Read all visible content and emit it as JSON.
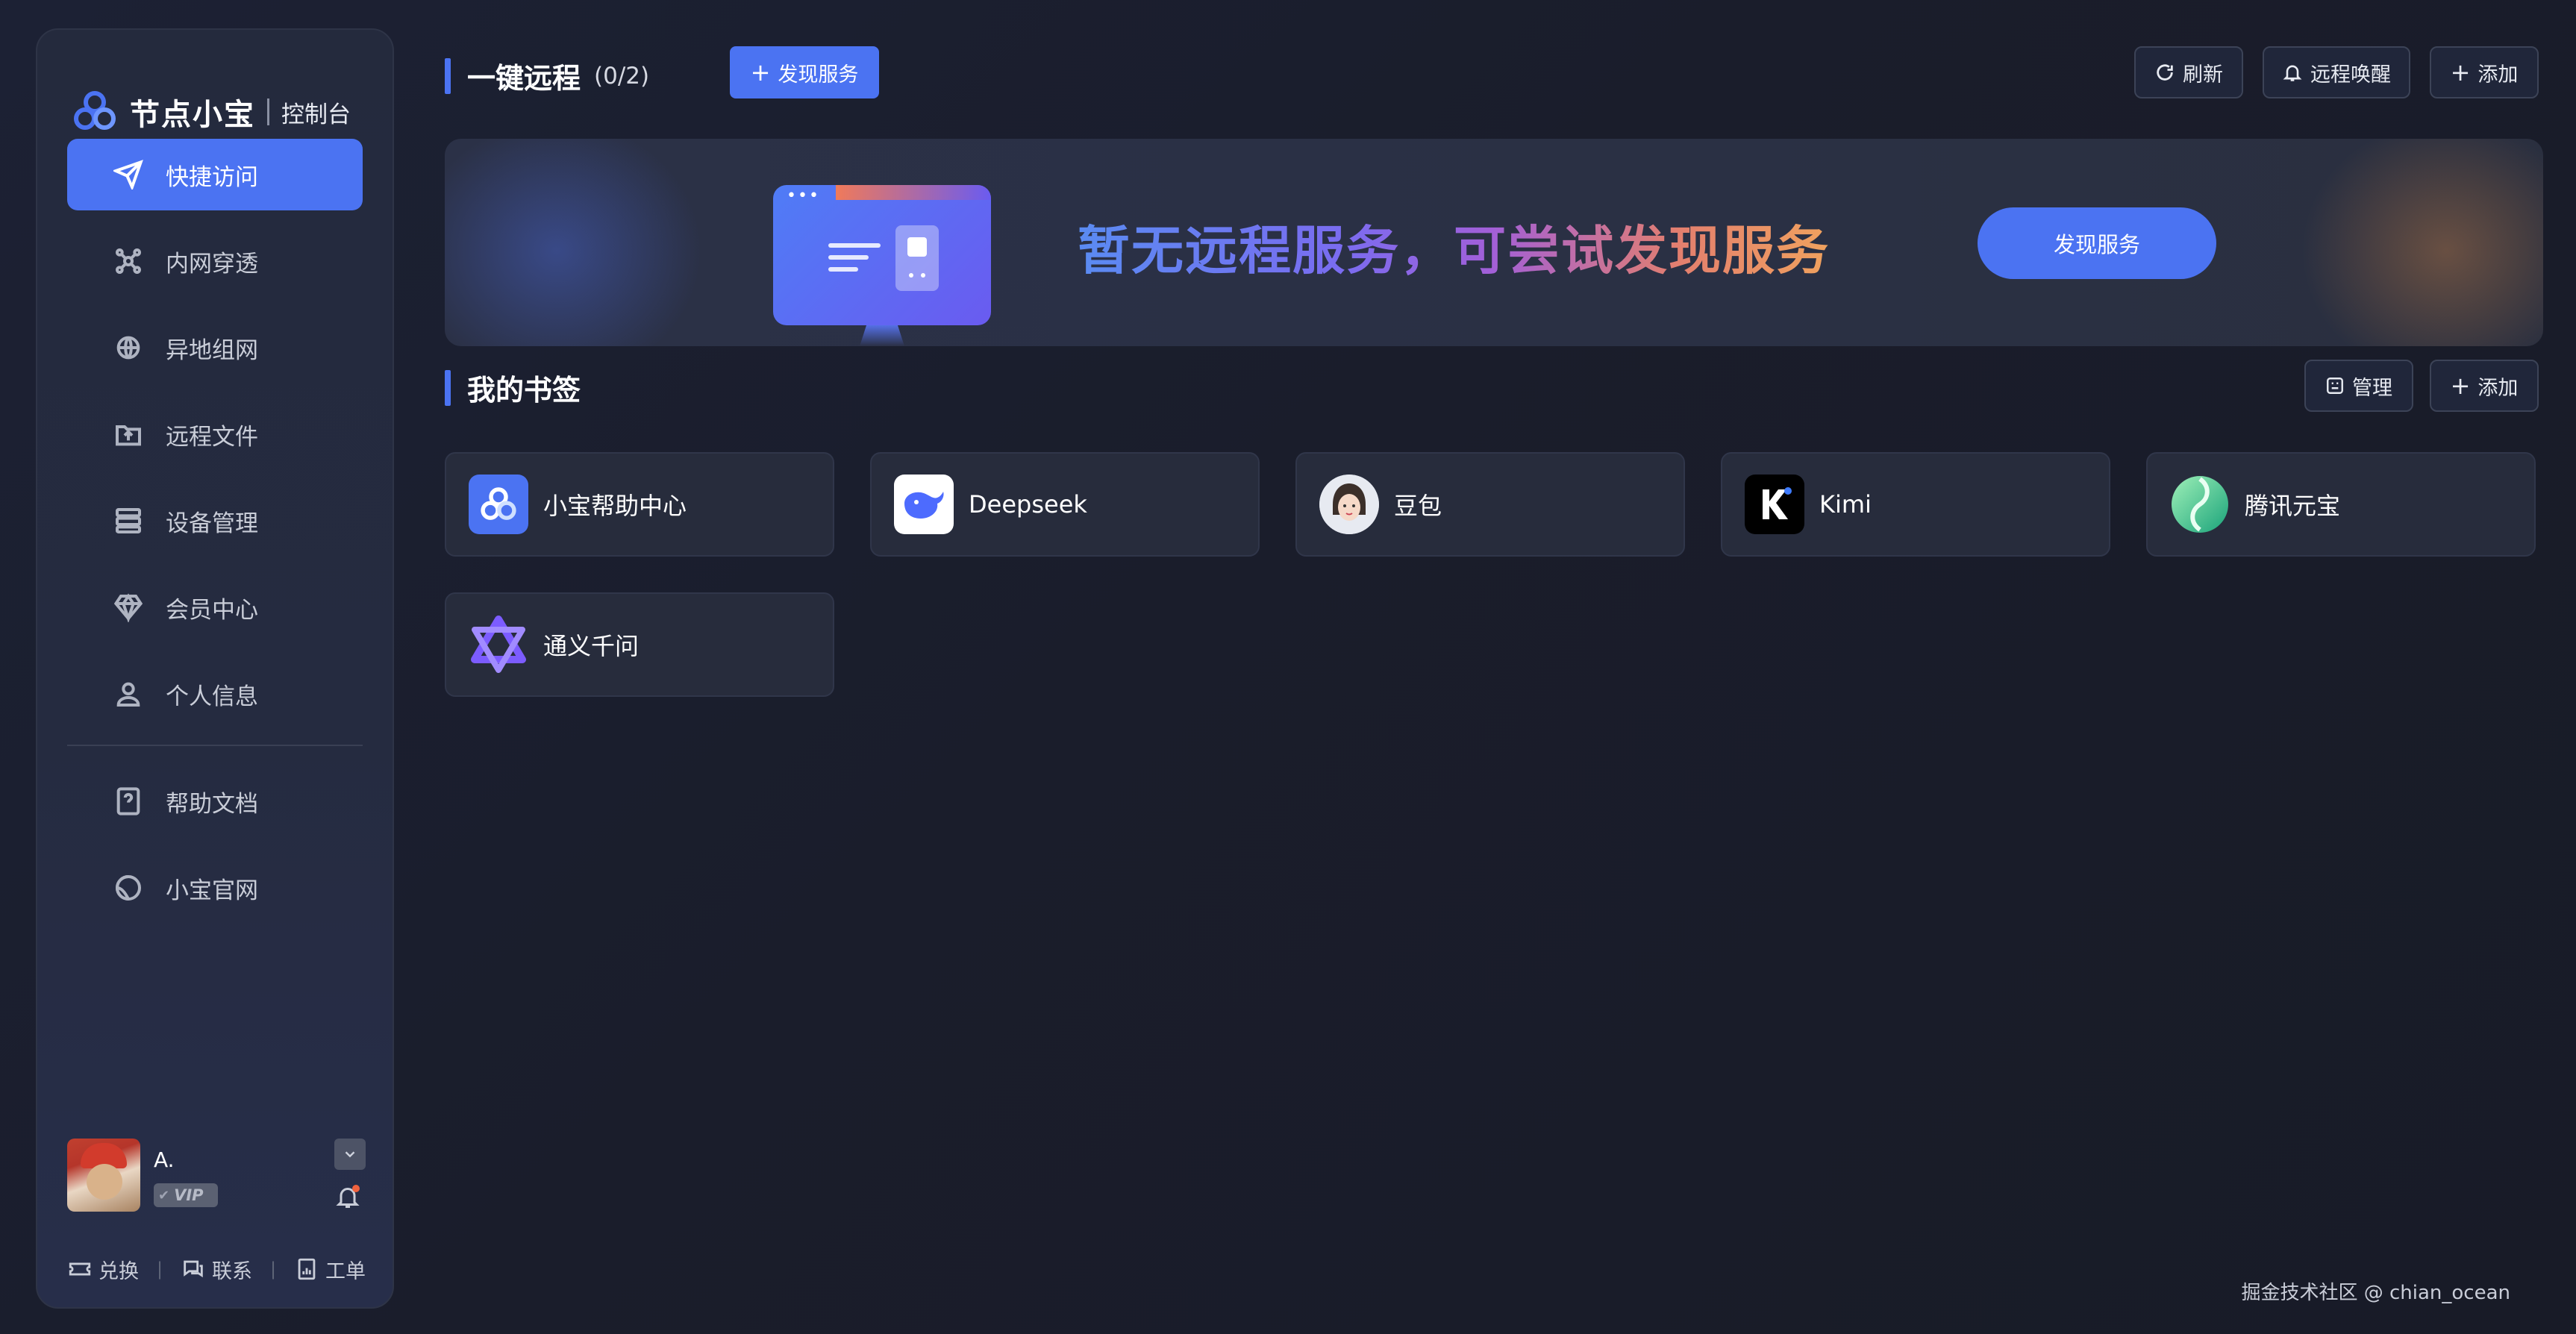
{
  "brand": {
    "name": "节点小宝",
    "console_label": "控制台"
  },
  "nav": {
    "items": [
      {
        "label": "快捷访问",
        "icon": "paper-plane-icon",
        "active": true
      },
      {
        "label": "内网穿透",
        "icon": "network-nodes-icon",
        "active": false
      },
      {
        "label": "异地组网",
        "icon": "globe-link-icon",
        "active": false
      },
      {
        "label": "远程文件",
        "icon": "folder-upload-icon",
        "active": false
      },
      {
        "label": "设备管理",
        "icon": "server-list-icon",
        "active": false
      },
      {
        "label": "会员中心",
        "icon": "diamond-icon",
        "active": false
      },
      {
        "label": "个人信息",
        "icon": "user-icon",
        "active": false
      },
      {
        "label": "帮助文档",
        "icon": "help-doc-icon",
        "active": false
      },
      {
        "label": "小宝官网",
        "icon": "website-icon",
        "active": false
      }
    ]
  },
  "user": {
    "name": "A.",
    "badge": "VIP"
  },
  "bottom_links": {
    "redeem": "兑换",
    "contact": "联系",
    "ticket": "工单"
  },
  "remote": {
    "title": "一键远程",
    "count": "(0/2)",
    "discover_label": "发现服务",
    "refresh_label": "刷新",
    "wake_label": "远程唤醒",
    "add_label": "添加"
  },
  "banner": {
    "message": "暂无远程服务，可尝试发现服务",
    "button_label": "发现服务"
  },
  "bookmarks": {
    "title": "我的书签",
    "manage_label": "管理",
    "add_label": "添加",
    "items": [
      {
        "label": "小宝帮助中心",
        "icon": "xiaobao-logo-icon"
      },
      {
        "label": "Deepseek",
        "icon": "deepseek-whale-icon"
      },
      {
        "label": "豆包",
        "icon": "doubao-avatar-icon"
      },
      {
        "label": "Kimi",
        "icon": "kimi-logo-icon"
      },
      {
        "label": "腾讯元宝",
        "icon": "yuanbao-logo-icon"
      },
      {
        "label": "通义千问",
        "icon": "tongyi-logo-icon"
      }
    ]
  },
  "footer": {
    "watermark": "掘金技术社区 @ chian_ocean"
  },
  "colors": {
    "accent": "#4b73f2",
    "background": "#1a1d2b",
    "card": "#272c3c"
  }
}
